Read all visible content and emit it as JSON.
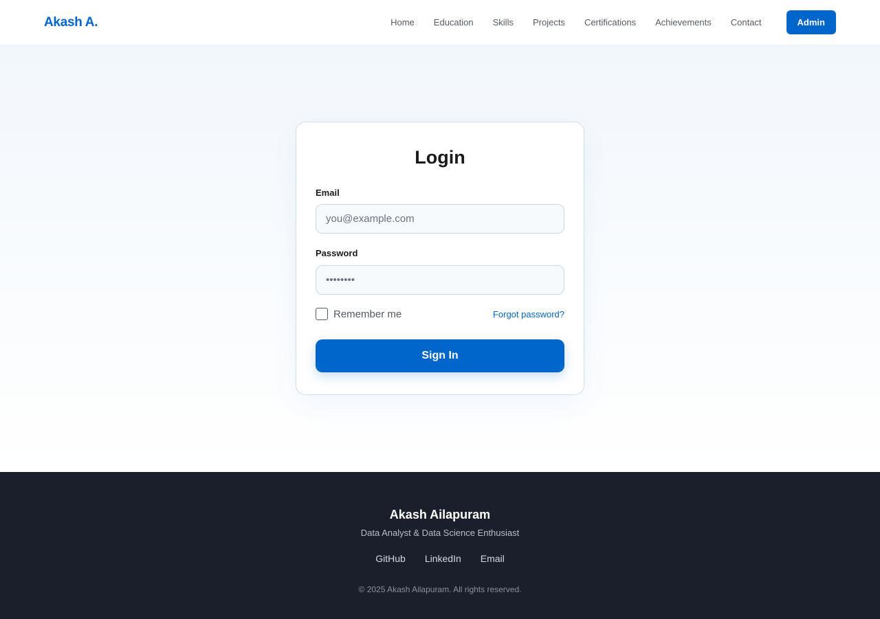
{
  "header": {
    "brand": "Akash A.",
    "nav": [
      {
        "label": "Home"
      },
      {
        "label": "Education"
      },
      {
        "label": "Skills"
      },
      {
        "label": "Projects"
      },
      {
        "label": "Certifications"
      },
      {
        "label": "Achievements"
      },
      {
        "label": "Contact"
      }
    ],
    "admin_label": "Admin"
  },
  "login": {
    "title": "Login",
    "email_label": "Email",
    "email_placeholder": "you@example.com",
    "password_label": "Password",
    "password_placeholder": "••••••••",
    "remember_label": "Remember me",
    "remember_checked": false,
    "forgot_label": "Forgot password?",
    "submit_label": "Sign In"
  },
  "footer": {
    "name": "Akash Ailapuram",
    "tagline": "Data Analyst & Data Science Enthusiast",
    "links": [
      {
        "label": "GitHub"
      },
      {
        "label": "LinkedIn"
      },
      {
        "label": "Email"
      }
    ],
    "copyright": "© 2025 Akash Ailapuram. All rights reserved."
  },
  "colors": {
    "accent": "#0066cc",
    "footer_bg": "#1b1f2b",
    "text": "#1a1a1a",
    "muted": "#555b66"
  }
}
